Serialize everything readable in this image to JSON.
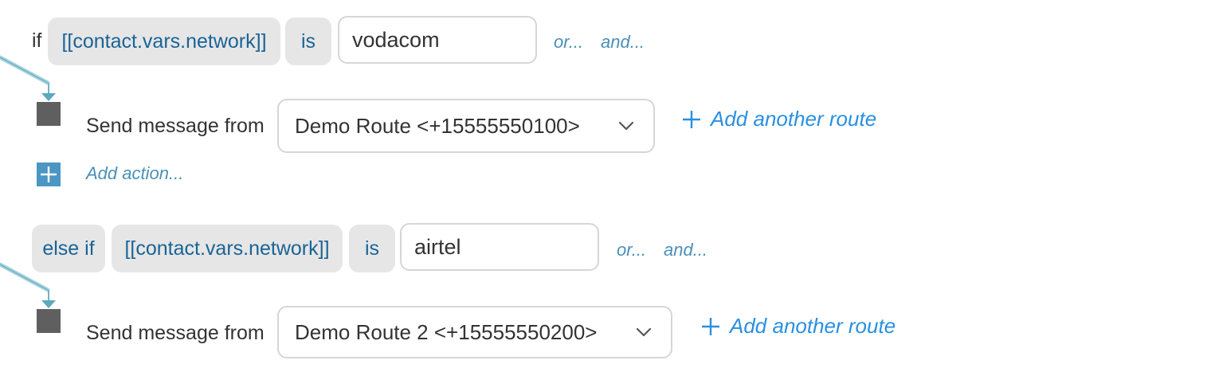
{
  "conditions": [
    {
      "keyword": "if",
      "field": "[[contact.vars.network]]",
      "operator": "is",
      "value": "vodacom",
      "or_label": "or...",
      "and_label": "and...",
      "action": {
        "label": "Send message from",
        "route": "Demo Route <+15555550100>",
        "add_route_label": "Add another route"
      },
      "add_action_label": "Add action..."
    },
    {
      "keyword": "else if",
      "field": "[[contact.vars.network]]",
      "operator": "is",
      "value": "airtel",
      "or_label": "or...",
      "and_label": "and...",
      "action": {
        "label": "Send message from",
        "route": "Demo Route 2 <+15555550200>",
        "add_route_label": "Add another route"
      }
    }
  ],
  "icons": {
    "chevron": "chevron-down-icon",
    "plus": "plus-icon",
    "add_action": "plus-square-icon"
  },
  "colors": {
    "pill_bg": "#e6e6e6",
    "pill_text": "#1a6496",
    "link": "#4a90b8",
    "add_route": "#2a8fe0",
    "connector": "#7fbfcf",
    "square": "#5f5f5f",
    "add_action_bg": "#4b96c2"
  }
}
